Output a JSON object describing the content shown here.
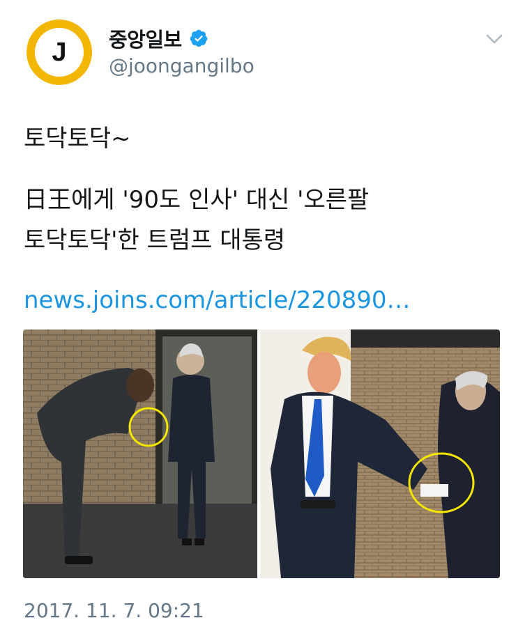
{
  "author": {
    "display_name": "중앙일보",
    "handle": "@joongangilbo",
    "avatar_letter": "J",
    "verified": true,
    "avatar_ring_color": "#f2b705"
  },
  "tweet": {
    "line1": "토닥토닥~",
    "line2": "日王에게 '90도 인사' 대신 '오른팔",
    "line3": "토닥토닥'한 트럼프 대통령",
    "link": "news.joins.com/article/220890…",
    "link_color": "#1b95e0"
  },
  "media": {
    "panels": 2,
    "highlight_color": "#f5e600"
  },
  "timestamp": "2017. 11. 7. 09:21",
  "icons": {
    "verified": "verified-badge-icon",
    "menu": "chevron-down-icon"
  }
}
